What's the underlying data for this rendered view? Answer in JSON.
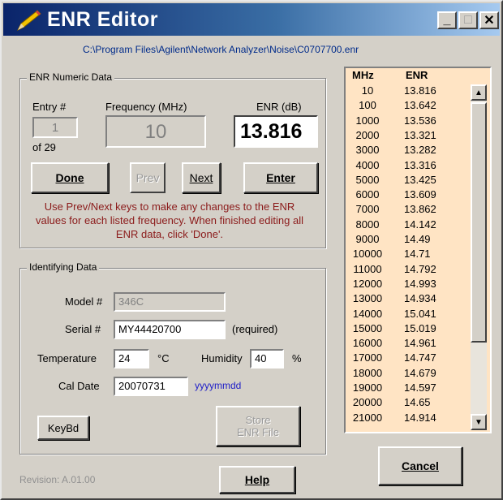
{
  "window": {
    "title": "ENR Editor",
    "file_path": "C:\\Program Files\\Agilent\\Network Analyzer\\Noise\\C0707700.enr",
    "controls": {
      "minimize": "_",
      "maximize": "□",
      "close": "✕"
    }
  },
  "numeric": {
    "group_title": "ENR Numeric Data",
    "entry_label": "Entry #",
    "entry_value": "1",
    "of_text": "of 29",
    "freq_label": "Frequency (MHz)",
    "freq_value": "10",
    "enr_label": "ENR (dB)",
    "enr_value": "13.816",
    "done_label": "Done",
    "prev_label": "Prev",
    "next_label": "Next",
    "enter_label": "Enter",
    "help_text": "Use Prev/Next keys to make any changes to the ENR values for each listed frequency.  When finished editing all ENR data, click 'Done'."
  },
  "identifying": {
    "group_title": "Identifying Data",
    "model_label": "Model #",
    "model_value": "346C",
    "serial_label": "Serial #",
    "serial_value": "MY44420700",
    "required_text": "(required)",
    "temp_label": "Temperature",
    "temp_value": "24",
    "temp_unit": "°C",
    "humidity_label": "Humidity",
    "humidity_value": "40",
    "humidity_unit": "%",
    "cal_date_label": "Cal Date",
    "cal_date_value": "20070731",
    "cal_date_format": "yyyymmdd",
    "keybd_label": "KeyBd",
    "store_label_1": "Store",
    "store_label_2": "ENR File"
  },
  "footer": {
    "revision": "Revision: A.01.00",
    "help_label": "Help",
    "cancel_label": "Cancel"
  },
  "table": {
    "col_mhz": "MHz",
    "col_enr": "ENR",
    "rows": [
      {
        "mhz": "10",
        "enr": "13.816"
      },
      {
        "mhz": "100",
        "enr": "13.642"
      },
      {
        "mhz": "1000",
        "enr": "13.536"
      },
      {
        "mhz": "2000",
        "enr": "13.321"
      },
      {
        "mhz": "3000",
        "enr": "13.282"
      },
      {
        "mhz": "4000",
        "enr": "13.316"
      },
      {
        "mhz": "5000",
        "enr": "13.425"
      },
      {
        "mhz": "6000",
        "enr": "13.609"
      },
      {
        "mhz": "7000",
        "enr": "13.862"
      },
      {
        "mhz": "8000",
        "enr": "14.142"
      },
      {
        "mhz": "9000",
        "enr": "14.49"
      },
      {
        "mhz": "10000",
        "enr": "14.71"
      },
      {
        "mhz": "11000",
        "enr": "14.792"
      },
      {
        "mhz": "12000",
        "enr": "14.993"
      },
      {
        "mhz": "13000",
        "enr": "14.934"
      },
      {
        "mhz": "14000",
        "enr": "15.041"
      },
      {
        "mhz": "15000",
        "enr": "15.019"
      },
      {
        "mhz": "16000",
        "enr": "14.961"
      },
      {
        "mhz": "17000",
        "enr": "14.747"
      },
      {
        "mhz": "18000",
        "enr": "14.679"
      },
      {
        "mhz": "19000",
        "enr": "14.597"
      },
      {
        "mhz": "20000",
        "enr": "14.65"
      },
      {
        "mhz": "21000",
        "enr": "14.914"
      }
    ]
  },
  "colors": {
    "title_gradient_start": "#0a246a",
    "title_gradient_end": "#a6caf0",
    "path_text": "#002b8a",
    "help_text": "#8b1a1a",
    "list_background": "#ffe4c4",
    "date_format_hint": "#2020c8"
  },
  "icons": {
    "app_icon": "pencil-icon",
    "scroll_up": "scroll-up-arrow-icon",
    "scroll_down": "scroll-down-arrow-icon"
  }
}
